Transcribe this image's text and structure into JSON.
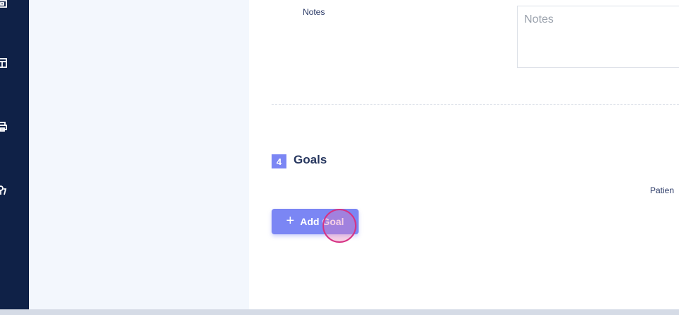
{
  "nav_rail": {
    "icons": [
      "calendar-icon",
      "calendar-list-icon",
      "printer-icon",
      "stethoscope-icon"
    ]
  },
  "notes": {
    "label": "Notes",
    "placeholder": "Notes",
    "value": ""
  },
  "goals_section": {
    "step_number": "4",
    "title": "Goals",
    "patient_label": "Patien",
    "add_button_label": "Add Goal",
    "add_button_icon": "plus-icon"
  },
  "colors": {
    "nav_background": "#0f2147",
    "accent": "#7b86f4",
    "side_panel": "#f3f7fd",
    "click_indicator": "#d63384"
  }
}
